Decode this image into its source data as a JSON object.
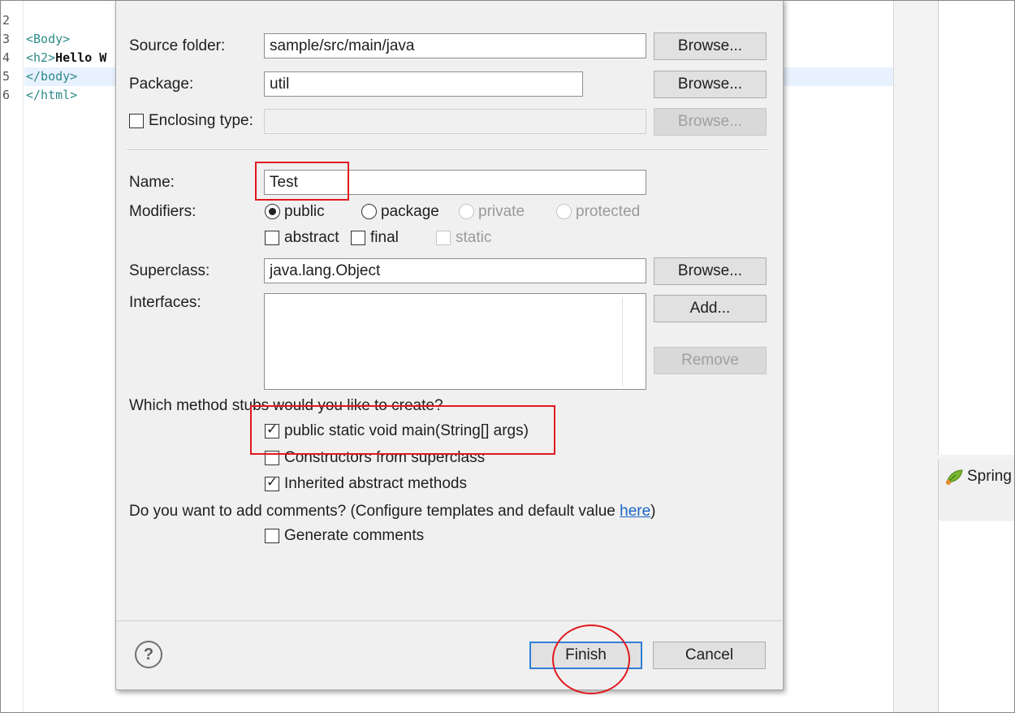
{
  "editor": {
    "lines": [
      {
        "num": "2",
        "code": "<Body>"
      },
      {
        "num": "3",
        "code": "<h2>",
        "bold": "Hello W"
      },
      {
        "num": "4",
        "code": "</body>"
      },
      {
        "num": "5",
        "code": "</html>"
      },
      {
        "num": "6",
        "code": ""
      }
    ]
  },
  "right_panel": {
    "tab_label": "Spring"
  },
  "dialog": {
    "source_folder": {
      "label": "Source folder:",
      "value": "sample/src/main/java",
      "browse": "Browse..."
    },
    "package": {
      "label": "Package:",
      "value": "util",
      "browse": "Browse..."
    },
    "enclosing_type": {
      "label": "Enclosing type:",
      "value": "",
      "browse": "Browse..."
    },
    "name": {
      "label": "Name:",
      "value": "Test"
    },
    "modifiers": {
      "label": "Modifiers:",
      "options": [
        "public",
        "package",
        "private",
        "protected"
      ],
      "selected": "public",
      "checks": [
        "abstract",
        "final",
        "static"
      ]
    },
    "superclass": {
      "label": "Superclass:",
      "value": "java.lang.Object",
      "browse": "Browse..."
    },
    "interfaces": {
      "label": "Interfaces:",
      "add": "Add...",
      "remove": "Remove"
    },
    "stubs": {
      "question": "Which method stubs would you like to create?",
      "main": "public static void main(String[] args)",
      "constructors": "Constructors from superclass",
      "inherited": "Inherited abstract methods"
    },
    "comments": {
      "question_prefix": "Do you want to add comments? (Configure templates and default value ",
      "link": "here",
      "question_suffix": ")",
      "generate": "Generate comments"
    },
    "buttons": {
      "finish": "Finish",
      "cancel": "Cancel",
      "help": "?"
    }
  },
  "annotation_color": "#e0191f"
}
